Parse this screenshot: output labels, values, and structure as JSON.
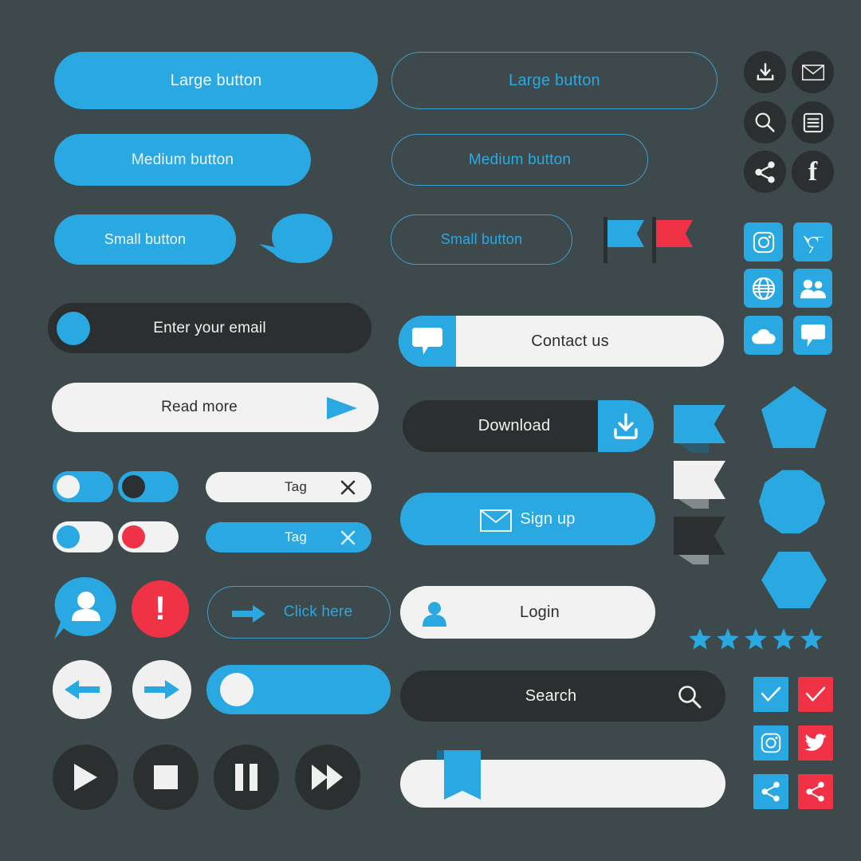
{
  "theme": {
    "background": "#3d494b",
    "blue": "#29a8e2",
    "red": "#f03247",
    "dark": "#2b2f30",
    "light": "#f2f2f2",
    "blue_text": "#2aa9e4"
  },
  "column_left": {
    "filled_buttons": [
      {
        "label": "Large button"
      },
      {
        "label": "Medium button"
      },
      {
        "label": "Small button"
      }
    ],
    "speech_bubble": {
      "icon": "speech-bubble-shape"
    },
    "email_field": {
      "value": "Enter your email",
      "icon": "blue-dot-avatar"
    },
    "read_more": {
      "label": "Read more",
      "icon": "play-triangle-icon"
    },
    "toggles": [
      {
        "name": "toggle-blue-white-knob",
        "track": "#29a8e2",
        "knob": "#f2f2f2",
        "state": "off"
      },
      {
        "name": "toggle-blue-dark-knob",
        "track": "#29a8e2",
        "knob": "#2b2f30",
        "state": "off"
      },
      {
        "name": "toggle-white-blue-knob",
        "track": "#f2f2f2",
        "knob": "#29a8e2",
        "state": "off"
      },
      {
        "name": "toggle-white-red-knob",
        "track": "#f2f2f2",
        "knob": "#f03247",
        "state": "off"
      }
    ],
    "tags": [
      {
        "label": "Tag",
        "style": "light",
        "close_icon": "close-icon"
      },
      {
        "label": "Tag",
        "style": "blue",
        "close_icon": "close-icon"
      }
    ],
    "avatar_bubble": {
      "icon": "user-speech-bubble-icon"
    },
    "alert": {
      "icon": "exclamation-icon",
      "glyph": "!"
    },
    "click_here": {
      "label": "Click here",
      "icon": "arrow-right-icon"
    },
    "nav_arrows": [
      {
        "name": "prev-button",
        "icon": "arrow-left-icon"
      },
      {
        "name": "next-button",
        "icon": "arrow-right-icon"
      }
    ],
    "slider": {
      "name": "slider-blue",
      "knob": "#f2f2f2"
    },
    "media_controls": [
      {
        "name": "play-button",
        "icon": "play-icon"
      },
      {
        "name": "stop-button",
        "icon": "stop-icon"
      },
      {
        "name": "pause-button",
        "icon": "pause-icon"
      },
      {
        "name": "fast-forward-button",
        "icon": "fast-forward-icon"
      }
    ]
  },
  "column_middle": {
    "outline_buttons": [
      {
        "label": "Large button"
      },
      {
        "label": "Medium button"
      },
      {
        "label": "Small button"
      }
    ],
    "flags": [
      {
        "name": "flag-blue",
        "color": "#29a8e2"
      },
      {
        "name": "flag-red",
        "color": "#f03247"
      }
    ],
    "contact_us": {
      "label": "Contact us",
      "icon": "chat-bubble-icon"
    },
    "download": {
      "label": "Download",
      "icon": "download-icon"
    },
    "sign_up": {
      "label": "Sign up",
      "icon": "envelope-icon"
    },
    "login": {
      "label": "Login",
      "icon": "user-icon"
    },
    "search": {
      "label": "Search",
      "icon": "search-icon"
    },
    "progress": {
      "name": "progress-bar",
      "bookmark_icon": "bookmark-icon"
    },
    "ribbons": [
      {
        "name": "ribbon-blue",
        "color": "#29a8e2"
      },
      {
        "name": "ribbon-white",
        "color": "#f0f0f0"
      },
      {
        "name": "ribbon-dark",
        "color": "#2b2f30"
      }
    ]
  },
  "column_right": {
    "circle_icons": [
      {
        "name": "download-icon"
      },
      {
        "name": "envelope-icon"
      },
      {
        "name": "search-icon"
      },
      {
        "name": "list-icon"
      },
      {
        "name": "share-icon"
      },
      {
        "name": "facebook-icon",
        "glyph": "f"
      }
    ],
    "social_tiles": [
      {
        "name": "instagram-icon"
      },
      {
        "name": "chrome-icon"
      },
      {
        "name": "globe-icon"
      },
      {
        "name": "users-icon"
      },
      {
        "name": "cloud-upload-icon"
      },
      {
        "name": "chat-bubble-icon"
      }
    ],
    "shapes": [
      {
        "name": "pentagon-shape"
      },
      {
        "name": "octagon-shape"
      },
      {
        "name": "hexagon-shape"
      }
    ],
    "rating": {
      "stars": 5,
      "filled": 5,
      "color": "#29a8e2"
    },
    "square_icons": [
      {
        "name": "check-icon",
        "style": "blue"
      },
      {
        "name": "check-icon",
        "style": "red"
      },
      {
        "name": "instagram-icon",
        "style": "blue"
      },
      {
        "name": "twitter-icon",
        "style": "red"
      },
      {
        "name": "share-icon",
        "style": "blue"
      },
      {
        "name": "share-icon",
        "style": "red"
      }
    ]
  }
}
